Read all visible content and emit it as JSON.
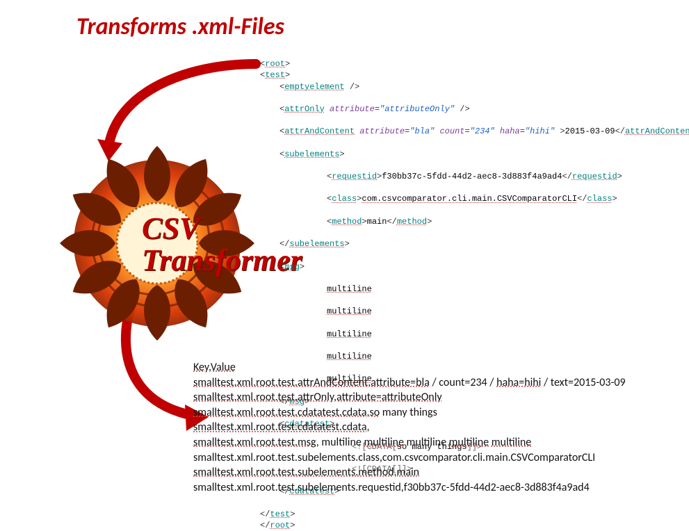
{
  "title": "Transforms .xml-Files",
  "logo": {
    "line1": "CSV",
    "line2": "Transformer"
  },
  "xml": {
    "root_open": "root",
    "test_open": "test",
    "empty": "emptyelement",
    "attrOnly_tag": "attrOnly",
    "attrOnly_attr": "attribute",
    "attrOnly_val": "attributeOnly",
    "aac_tag": "attrAndContent",
    "aac_a1n": "attribute",
    "aac_a1v": "bla",
    "aac_a2n": "count",
    "aac_a2v": "234",
    "aac_a3n": "haha",
    "aac_a3v": "hihi",
    "aac_text": "2015-03-09",
    "sub_open": "subelements",
    "rid_tag": "requestid",
    "rid_text": "f30bb37c-5fdd-44d2-aec8-3d883f4a9ad4",
    "cls_tag": "class",
    "cls_text": "com.csvcomparator.cli.main.CSVComparatorCLI",
    "mth_tag": "method",
    "mth_text": "main",
    "sub_close": "subelements",
    "msg_open": "msg",
    "ml": "multiline",
    "msg_close": "msg",
    "cdt_open": "cdatatest",
    "cd1": "so many things",
    "cdt_close": "cdatatest",
    "test_close": "test",
    "root_close": "root"
  },
  "csv": {
    "header": "Key,Value",
    "r1a": "smalltest.xml.root.test.attrAndContent,attribute=bla",
    "r1b": " / count=234 / ",
    "r1c": "haha=hihi",
    "r1d": " / text=2015-03-09",
    "r2": "smalltest.xml.root.test.attrOnly,attribute=attributeOnly",
    "r3a": "smalltest.xml.root.test.cdatatest.cdata,so",
    "r3b": " many things",
    "r4": "smalltest.xml.root.test.cdatatest.cdata,",
    "r5a": "smalltest.xml.root.test.msg",
    "r5b": ",  multiline  ",
    "r5c": "multiline",
    "r5d": "  multiline  ",
    "r5e": "multiline",
    "r5f": "  ",
    "r5g": "multiline",
    "r6": "smalltest.xml.root.test.subelements.class,com.csvcomparator.cli.main.CSVComparatorCLI",
    "r7": "smalltest.xml.root.test.subelements.method,main",
    "r8": "smalltest.xml.root.test.subelements.requestid,f30bb37c-5fdd-44d2-aec8-3d883f4a9ad4"
  }
}
